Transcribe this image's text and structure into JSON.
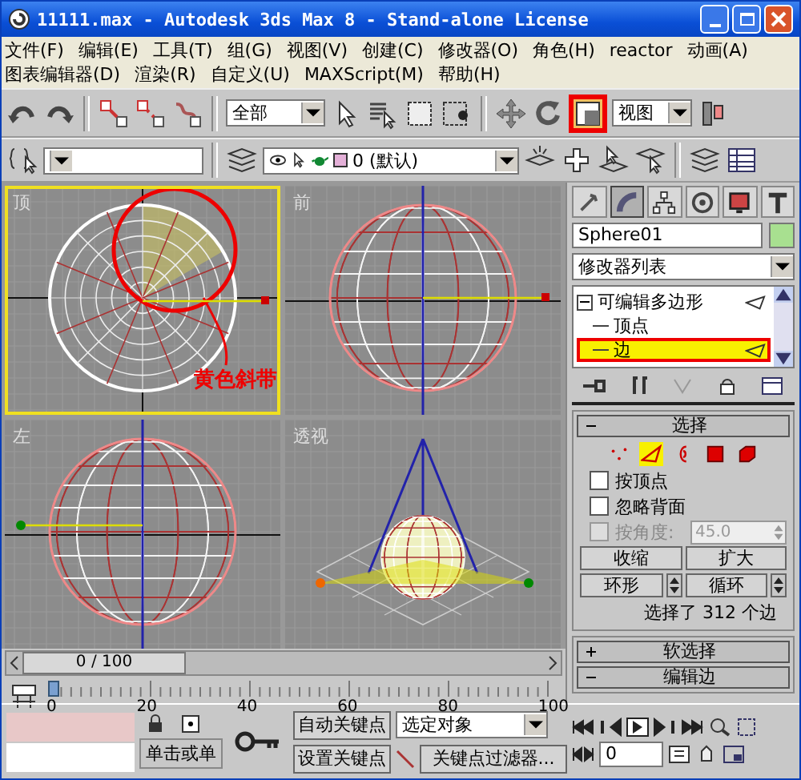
{
  "window": {
    "title": "11111.max - Autodesk 3ds Max 8  - Stand-alone License"
  },
  "menu_rows": [
    [
      "文件(F)",
      "编辑(E)",
      "工具(T)",
      "组(G)",
      "视图(V)",
      "创建(C)",
      "修改器(O)",
      "角色(H)",
      "reactor",
      "动画(A)"
    ],
    [
      "图表编辑器(D)",
      "渲染(R)",
      "自定义(U)",
      "MAXScript(M)",
      "帮助(H)"
    ]
  ],
  "main_toolbar": {
    "selection_filter": "全部",
    "reference_coordinate": "视图",
    "scale_marked": true
  },
  "layer_toolbar": {
    "layer": "0 (默认)"
  },
  "viewports": [
    {
      "label": "顶",
      "kind": "top",
      "active": true,
      "callout": "黄色斜带"
    },
    {
      "label": "前",
      "kind": "front",
      "active": false
    },
    {
      "label": "左",
      "kind": "left",
      "active": false
    },
    {
      "label": "透视",
      "kind": "perspective",
      "active": false
    }
  ],
  "command_panel": {
    "tabs": [
      {
        "selected": false
      },
      {
        "selected": true
      },
      {
        "selected": false
      },
      {
        "selected": false
      },
      {
        "selected": false
      },
      {
        "selected": false
      }
    ],
    "object_name": "Sphere01",
    "modifier_list": "修改器列表",
    "stack": [
      {
        "label": "可编辑多边形",
        "expanded": true,
        "children": [
          {
            "label": "顶点",
            "selected": false,
            "marked": false
          },
          {
            "label": "边",
            "selected": true,
            "marked": true
          }
        ]
      }
    ],
    "selection": {
      "title": "选择",
      "expanded": true,
      "levels": [
        {
          "selected": false
        },
        {
          "selected": true
        },
        {
          "selected": false
        },
        {
          "selected": false
        },
        {
          "selected": false
        }
      ],
      "options": [
        {
          "label": "按顶点",
          "checked": false,
          "disabled": false
        },
        {
          "label": "忽略背面",
          "checked": false,
          "disabled": false
        },
        {
          "label": "按角度:",
          "checked": false,
          "disabled": true
        }
      ],
      "angle_value": "45.0",
      "grow_buttons": [
        "收缩",
        "扩大"
      ],
      "ring_loop": [
        "环形",
        "循环"
      ],
      "status": "选择了 312 个边"
    },
    "rollouts": [
      {
        "title": "软选择",
        "expanded": false
      },
      {
        "title": "编辑边",
        "expanded": true
      }
    ]
  },
  "timeline": {
    "position": "0 / 100",
    "level": 0,
    "ruler_labels": [
      "0",
      "20",
      "40",
      "60",
      "80",
      "100"
    ]
  },
  "bottom_bar": {
    "prompt": "单击或单",
    "auto_key": "自动关键点",
    "set_key": "设置关键点",
    "key_mode": "选定对象",
    "key_filters": "关键点过滤器...",
    "frame": "0"
  }
}
